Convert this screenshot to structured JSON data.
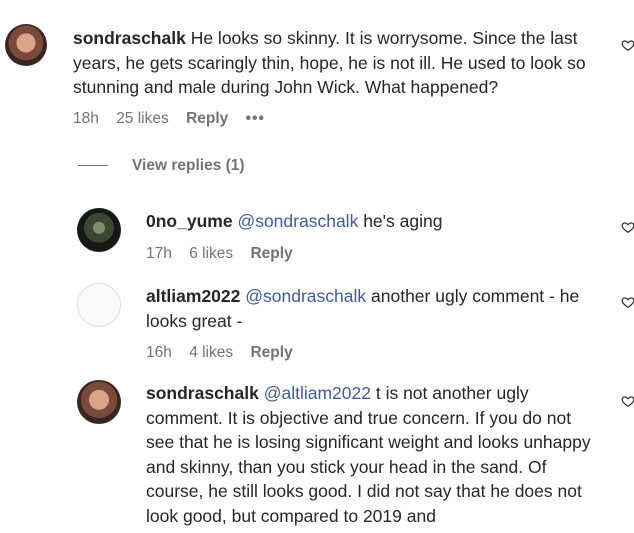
{
  "comments": [
    {
      "username": "sondraschalk",
      "mention": "",
      "text": "He looks so skinny. It is worrysome. Since the last years, he gets scaringly thin, hope, he is not ill. He used to look so stunning and male during John Wick. What happened?",
      "time": "18h",
      "likes": "25 likes",
      "reply": "Reply",
      "more": "•••"
    },
    {
      "username": "0no_yume",
      "mention": "@sondraschalk",
      "text": "he's aging",
      "time": "17h",
      "likes": "6 likes",
      "reply": "Reply"
    },
    {
      "username": "altliam2022",
      "mention": "@sondraschalk",
      "text": "another ugly comment - he looks great -",
      "time": "16h",
      "likes": "4 likes",
      "reply": "Reply"
    },
    {
      "username": "sondraschalk",
      "mention": "@altliam2022",
      "text": "t is not another ugly comment. It is objective and true concern. If you do not see that he is losing significant weight and looks unhappy and skinny, than you stick your head in the sand. Of course, he still looks good. I did not say that he does not look good, but compared to 2019 and"
    }
  ],
  "view_replies": "View replies (1)"
}
